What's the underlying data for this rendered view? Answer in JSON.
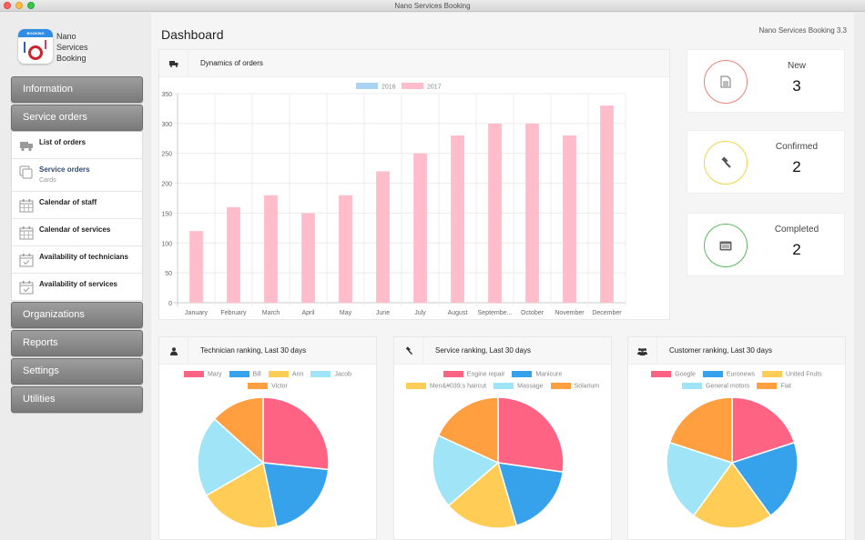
{
  "window": {
    "title": "Nano Services Booking"
  },
  "brand": {
    "line1": "Nano",
    "line2": "Services",
    "line3": "Booking",
    "logo_band": "BOOKING"
  },
  "sidebar": {
    "top_buttons": [
      {
        "label": "Information",
        "icon": "none"
      },
      {
        "label": "Service orders",
        "icon": "none"
      }
    ],
    "submenu": [
      {
        "label": "List of orders",
        "icon": "truck-icon"
      },
      {
        "label": "Service orders",
        "sublabel": "Cards",
        "icon": "cards-icon",
        "active": true
      },
      {
        "label": "Calendar of staff",
        "icon": "calendar-icon"
      },
      {
        "label": "Calendar of services",
        "icon": "calendar-icon"
      },
      {
        "label": "Availability of technicians",
        "icon": "calendar-check-icon"
      },
      {
        "label": "Availability of services",
        "icon": "calendar-check-icon"
      }
    ],
    "bottom_buttons": [
      {
        "label": "Organizations"
      },
      {
        "label": "Reports"
      },
      {
        "label": "Settings"
      },
      {
        "label": "Utilities"
      }
    ]
  },
  "header": {
    "title": "Dashboard",
    "version": "Nano Services Booking 3.3"
  },
  "orders_panel": {
    "title": "Dynamics of orders",
    "icon": "truck-icon"
  },
  "stats": [
    {
      "label": "New",
      "value": "3",
      "icon": "document-icon",
      "color": "#e8837a"
    },
    {
      "label": "Confirmed",
      "value": "2",
      "icon": "gavel-icon",
      "color": "#f2d34a"
    },
    {
      "label": "Completed",
      "value": "2",
      "icon": "list-box-icon",
      "color": "#5cb85c"
    }
  ],
  "pie_panels": [
    {
      "title": "Technician ranking, Last 30 days",
      "icon": "user-icon"
    },
    {
      "title": "Service ranking, Last 30 days",
      "icon": "gavel-icon"
    },
    {
      "title": "Customer ranking, Last 30 days",
      "icon": "users-icon"
    }
  ],
  "colors": {
    "pie": [
      "#ff6384",
      "#36a2eb",
      "#ffcd56",
      "#a0e4f8",
      "#ff9f40"
    ],
    "bar_2016": "#a8d4f5",
    "bar_2017": "#ffbccb"
  },
  "chart_data": [
    {
      "type": "bar",
      "title": "Dynamics of orders",
      "categories": [
        "January",
        "February",
        "March",
        "April",
        "May",
        "June",
        "July",
        "August",
        "Septembe...",
        "October",
        "November",
        "December"
      ],
      "series": [
        {
          "name": "2016",
          "values": [
            0,
            0,
            0,
            0,
            0,
            0,
            0,
            0,
            0,
            0,
            0,
            0
          ]
        },
        {
          "name": "2017",
          "values": [
            120,
            160,
            180,
            150,
            180,
            220,
            250,
            280,
            300,
            300,
            280,
            330
          ]
        }
      ],
      "yticks": [
        0,
        50,
        100,
        150,
        200,
        250,
        300,
        350
      ],
      "ylim": [
        0,
        350
      ],
      "grid": true,
      "legend": "top-center",
      "xlabel": "",
      "ylabel": ""
    },
    {
      "type": "pie",
      "title": "Technician ranking, Last 30 days",
      "labels": [
        "Mary",
        "Bill",
        "Ann",
        "Jacob",
        "Victor"
      ],
      "values": [
        4,
        3,
        3,
        3,
        2
      ],
      "legend": "top"
    },
    {
      "type": "pie",
      "title": "Service ranking, Last 30 days",
      "labels": [
        "Engine repair",
        "Manicure",
        "Men&#039;s haircut",
        "Massage",
        "Solarium"
      ],
      "values": [
        3,
        2,
        2,
        2,
        2
      ],
      "legend": "top"
    },
    {
      "type": "pie",
      "title": "Customer ranking, Last 30 days",
      "labels": [
        "Google",
        "Euronews",
        "United Fruits",
        "General motors",
        "Fiat"
      ],
      "values": [
        1,
        1,
        1,
        1,
        1
      ],
      "legend": "top"
    }
  ]
}
